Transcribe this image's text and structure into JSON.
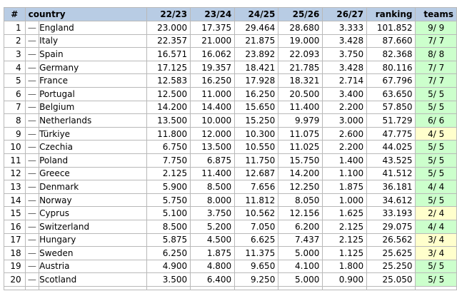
{
  "table": {
    "headers": {
      "rank": "#",
      "country": "country",
      "y1": "22/23",
      "y2": "23/24",
      "y3": "24/25",
      "y4": "25/26",
      "y5": "26/27",
      "ranking": "ranking",
      "teams": "teams"
    },
    "colors": {
      "header_bg": "#b8cce4",
      "teams_full_bg": "#ccffcc",
      "teams_partial_bg": "#ffffcc"
    },
    "trend_symbol": "—",
    "rows": [
      {
        "rank": "1",
        "trend": "—",
        "country": "England",
        "y1": "23.000",
        "y2": "17.375",
        "y3": "29.464",
        "y4": "28.680",
        "y5": "3.333",
        "ranking": "101.852",
        "teams": "9/ 9",
        "teams_status": "full"
      },
      {
        "rank": "2",
        "trend": "—",
        "country": "Italy",
        "y1": "22.357",
        "y2": "21.000",
        "y3": "21.875",
        "y4": "19.000",
        "y5": "3.428",
        "ranking": "87.660",
        "teams": "7/ 7",
        "teams_status": "full"
      },
      {
        "rank": "3",
        "trend": "—",
        "country": "Spain",
        "y1": "16.571",
        "y2": "16.062",
        "y3": "23.892",
        "y4": "22.093",
        "y5": "3.750",
        "ranking": "82.368",
        "teams": "8/ 8",
        "teams_status": "full"
      },
      {
        "rank": "4",
        "trend": "—",
        "country": "Germany",
        "y1": "17.125",
        "y2": "19.357",
        "y3": "18.421",
        "y4": "21.785",
        "y5": "3.428",
        "ranking": "80.116",
        "teams": "7/ 7",
        "teams_status": "full"
      },
      {
        "rank": "5",
        "trend": "—",
        "country": "France",
        "y1": "12.583",
        "y2": "16.250",
        "y3": "17.928",
        "y4": "18.321",
        "y5": "2.714",
        "ranking": "67.796",
        "teams": "7/ 7",
        "teams_status": "full"
      },
      {
        "rank": "6",
        "trend": "—",
        "country": "Portugal",
        "y1": "12.500",
        "y2": "11.000",
        "y3": "16.250",
        "y4": "20.500",
        "y5": "3.400",
        "ranking": "63.650",
        "teams": "5/ 5",
        "teams_status": "full"
      },
      {
        "rank": "7",
        "trend": "—",
        "country": "Belgium",
        "y1": "14.200",
        "y2": "14.400",
        "y3": "15.650",
        "y4": "11.400",
        "y5": "2.200",
        "ranking": "57.850",
        "teams": "5/ 5",
        "teams_status": "full"
      },
      {
        "rank": "8",
        "trend": "—",
        "country": "Netherlands",
        "y1": "13.500",
        "y2": "10.000",
        "y3": "15.250",
        "y4": "9.979",
        "y5": "3.000",
        "ranking": "51.729",
        "teams": "6/ 6",
        "teams_status": "full"
      },
      {
        "rank": "9",
        "trend": "—",
        "country": "Türkiye",
        "y1": "11.800",
        "y2": "12.000",
        "y3": "10.300",
        "y4": "11.075",
        "y5": "2.600",
        "ranking": "47.775",
        "teams": "4/ 5",
        "teams_status": "partial"
      },
      {
        "rank": "10",
        "trend": "—",
        "country": "Czechia",
        "y1": "6.750",
        "y2": "13.500",
        "y3": "10.550",
        "y4": "11.025",
        "y5": "2.200",
        "ranking": "44.025",
        "teams": "5/ 5",
        "teams_status": "full"
      },
      {
        "rank": "11",
        "trend": "—",
        "country": "Poland",
        "y1": "7.750",
        "y2": "6.875",
        "y3": "11.750",
        "y4": "15.750",
        "y5": "1.400",
        "ranking": "43.525",
        "teams": "5/ 5",
        "teams_status": "full"
      },
      {
        "rank": "12",
        "trend": "—",
        "country": "Greece",
        "y1": "2.125",
        "y2": "11.400",
        "y3": "12.687",
        "y4": "14.200",
        "y5": "1.100",
        "ranking": "41.512",
        "teams": "5/ 5",
        "teams_status": "full"
      },
      {
        "rank": "13",
        "trend": "—",
        "country": "Denmark",
        "y1": "5.900",
        "y2": "8.500",
        "y3": "7.656",
        "y4": "12.250",
        "y5": "1.875",
        "ranking": "36.181",
        "teams": "4/ 4",
        "teams_status": "full"
      },
      {
        "rank": "14",
        "trend": "—",
        "country": "Norway",
        "y1": "5.750",
        "y2": "8.000",
        "y3": "11.812",
        "y4": "8.050",
        "y5": "1.000",
        "ranking": "34.612",
        "teams": "5/ 5",
        "teams_status": "full"
      },
      {
        "rank": "15",
        "trend": "—",
        "country": "Cyprus",
        "y1": "5.100",
        "y2": "3.750",
        "y3": "10.562",
        "y4": "12.156",
        "y5": "1.625",
        "ranking": "33.193",
        "teams": "2/ 4",
        "teams_status": "partial"
      },
      {
        "rank": "16",
        "trend": "—",
        "country": "Switzerland",
        "y1": "8.500",
        "y2": "5.200",
        "y3": "7.050",
        "y4": "6.200",
        "y5": "2.125",
        "ranking": "29.075",
        "teams": "4/ 4",
        "teams_status": "full"
      },
      {
        "rank": "17",
        "trend": "—",
        "country": "Hungary",
        "y1": "5.875",
        "y2": "4.500",
        "y3": "6.625",
        "y4": "7.437",
        "y5": "2.125",
        "ranking": "26.562",
        "teams": "3/ 4",
        "teams_status": "partial"
      },
      {
        "rank": "18",
        "trend": "—",
        "country": "Sweden",
        "y1": "6.250",
        "y2": "1.875",
        "y3": "11.375",
        "y4": "5.000",
        "y5": "1.125",
        "ranking": "25.625",
        "teams": "3/ 4",
        "teams_status": "partial"
      },
      {
        "rank": "19",
        "trend": "—",
        "country": "Austria",
        "y1": "4.900",
        "y2": "4.800",
        "y3": "9.650",
        "y4": "4.100",
        "y5": "1.800",
        "ranking": "25.250",
        "teams": "5/ 5",
        "teams_status": "full"
      },
      {
        "rank": "20",
        "trend": "—",
        "country": "Scotland",
        "y1": "3.500",
        "y2": "6.400",
        "y3": "9.250",
        "y4": "5.000",
        "y5": "0.900",
        "ranking": "25.050",
        "teams": "5/ 5",
        "teams_status": "full"
      }
    ]
  }
}
